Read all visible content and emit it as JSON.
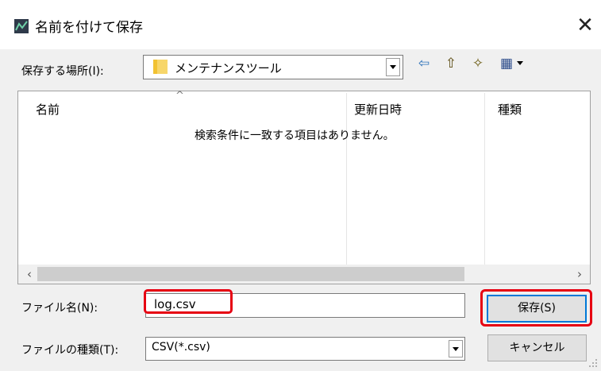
{
  "window": {
    "title": "名前を付けて保存",
    "close_glyph": "✕",
    "app_icon": "app-icon"
  },
  "location": {
    "label": "保存する場所(I):",
    "value": "メンテナンスツール",
    "icon": "folder-icon"
  },
  "toolbar": [
    {
      "name": "back-icon",
      "glyph": "⇦"
    },
    {
      "name": "up-folder-icon",
      "glyph": "⇧"
    },
    {
      "name": "new-folder-icon",
      "glyph": "✧"
    },
    {
      "name": "view-menu-icon",
      "glyph": "▦"
    }
  ],
  "file_list": {
    "columns": [
      "名前",
      "更新日時",
      "種類"
    ],
    "empty_message": "検索条件に一致する項目はありません。"
  },
  "file_name": {
    "label": "ファイル名(N):",
    "value": "log.csv"
  },
  "file_type": {
    "label": "ファイルの種類(T):",
    "value": "CSV(*.csv)"
  },
  "buttons": {
    "save": "保存(S)",
    "cancel": "キャンセル"
  },
  "colors": {
    "highlight": "#e60012",
    "folder": "#f7d66a",
    "accent": "#0078d7"
  }
}
